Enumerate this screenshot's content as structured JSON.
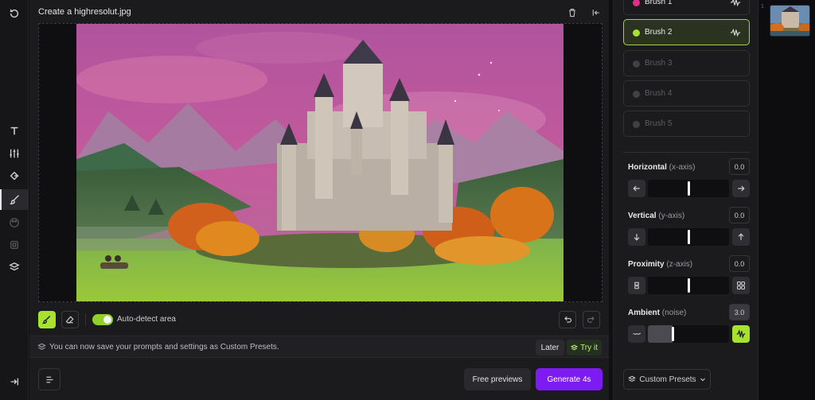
{
  "editor": {
    "title": "Create a highresolut.jpg",
    "auto_detect_label": "Auto-detect area",
    "info_text": "You can now save your prompts and settings as Custom Presets.",
    "later_label": "Later",
    "try_it_label": "Try it",
    "free_previews_label": "Free previews",
    "generate_label": "Generate 4s"
  },
  "brushes": [
    {
      "label": "Brush 1",
      "color": "#e0308c",
      "active": true
    },
    {
      "label": "Brush 2",
      "color": "#a6e22e",
      "active": true,
      "selected": true
    },
    {
      "label": "Brush 3",
      "color": "#404046",
      "active": false
    },
    {
      "label": "Brush 4",
      "color": "#404046",
      "active": false
    },
    {
      "label": "Brush 5",
      "color": "#404046",
      "active": false
    }
  ],
  "controls": {
    "horizontal": {
      "label": "Horizontal",
      "sub": "(x-axis)",
      "value": "0.0",
      "level": 0.5
    },
    "vertical": {
      "label": "Vertical",
      "sub": "(y-axis)",
      "value": "0.0",
      "level": 0.5
    },
    "proximity": {
      "label": "Proximity",
      "sub": "(z-axis)",
      "value": "0.0",
      "level": 0.5
    },
    "ambient": {
      "label": "Ambient",
      "sub": "(noise)",
      "value": "3.0",
      "level": 0.3
    }
  },
  "presets": {
    "label": "Custom Presets"
  },
  "strip": {
    "index": "1"
  },
  "colors": {
    "accent_green": "#a6e22e",
    "generate_purple": "#7d1cf2",
    "brush1_pink": "#e0308c"
  }
}
